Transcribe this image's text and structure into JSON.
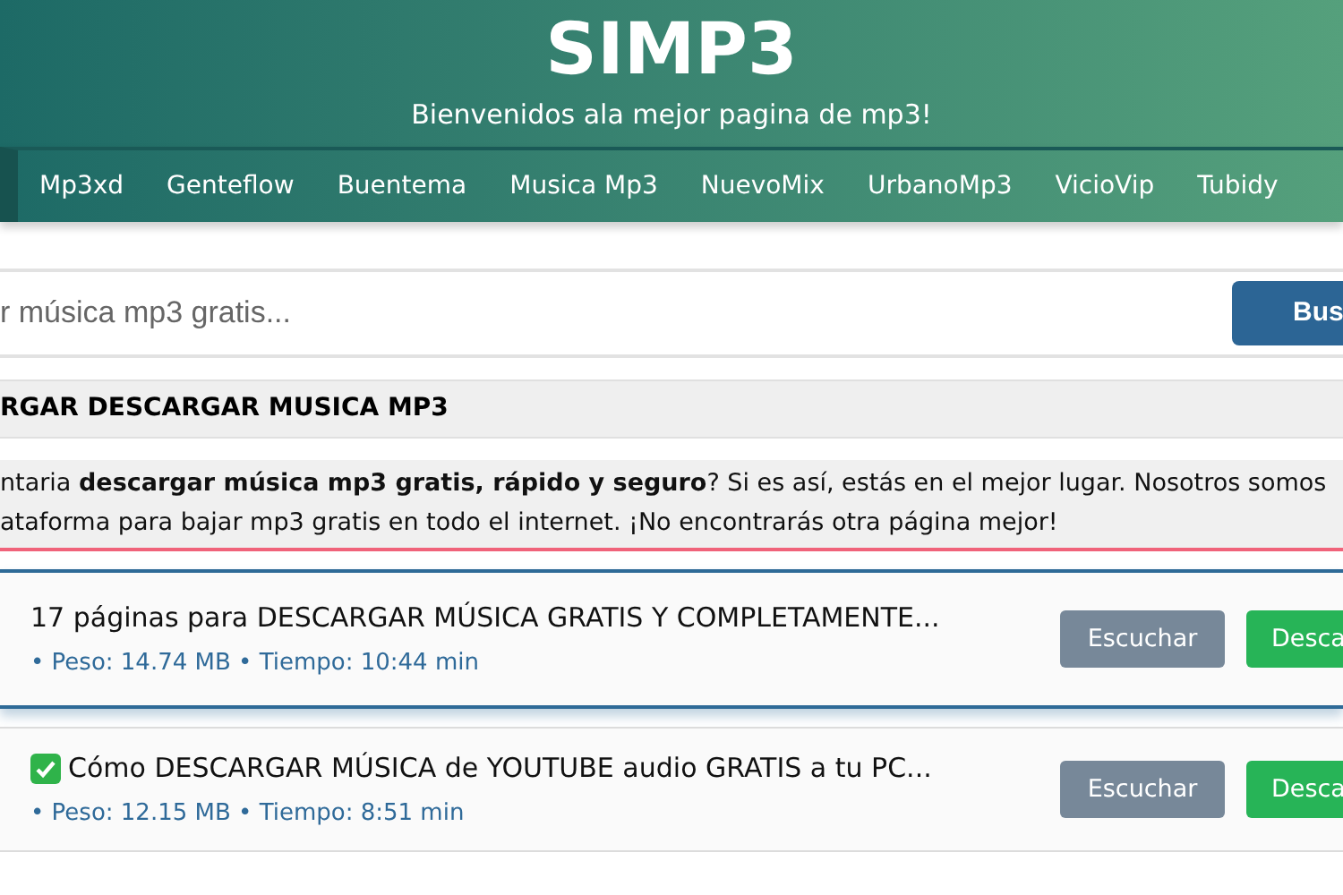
{
  "header": {
    "title": "SIMP3",
    "subtitle": "Bienvenidos ala mejor pagina de mp3!"
  },
  "nav": [
    {
      "label": "Mp3xd"
    },
    {
      "label": "Genteflow"
    },
    {
      "label": "Buentema"
    },
    {
      "label": "Musica Mp3"
    },
    {
      "label": "NuevoMix"
    },
    {
      "label": "UrbanoMp3"
    },
    {
      "label": "VicioVip"
    },
    {
      "label": "Tubidy"
    }
  ],
  "search": {
    "placeholder": "r música mp3 gratis...",
    "button": "Bus"
  },
  "section_title": "RGAR DESCARGAR MUSICA MP3",
  "intro": {
    "lines": [
      "ntaria **descargar música mp3 gratis, rápido y seguro**? Si es así, estás en el mejor lugar. Nosotros somos",
      "ataforma para bajar mp3 gratis en todo el internet. ¡No encontrarás otra página mejor!"
    ]
  },
  "results": [
    {
      "title": "17 páginas para DESCARGAR MÚSICA GRATIS Y COMPLETAMENTE...",
      "meta": "• Peso: 14.74 MB • Tiempo: 10:44 min",
      "check_icon": false,
      "selected": true,
      "listen": "Escuchar",
      "download": "Desca"
    },
    {
      "title": "Cómo DESCARGAR MÚSICA de YOUTUBE audio GRATIS a tu PC...",
      "meta": "• Peso: 12.15 MB • Tiempo: 8:51 min",
      "check_icon": true,
      "selected": false,
      "listen": "Escuchar",
      "download": "Desca"
    }
  ]
}
